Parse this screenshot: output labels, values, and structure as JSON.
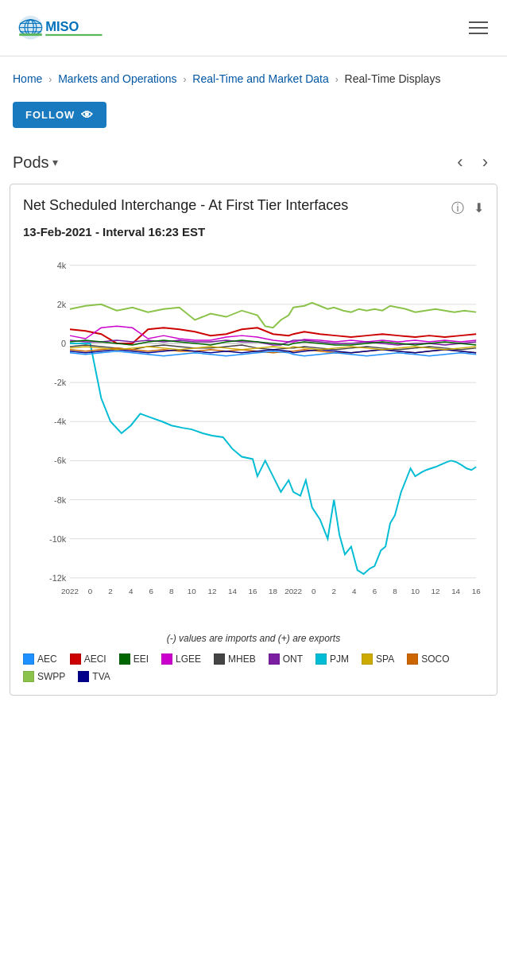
{
  "header": {
    "logo_alt": "MISO",
    "menu_icon": "hamburger-icon"
  },
  "breadcrumb": {
    "home": "Home",
    "markets": "Markets and Operations",
    "realtime": "Real-Time and Market Data",
    "displays": "Real-Time Displays"
  },
  "follow_button": {
    "label": "FOLLOW"
  },
  "pods_nav": {
    "label": "Pods",
    "dropdown_icon": "▾",
    "prev_icon": "‹",
    "next_icon": "›"
  },
  "chart": {
    "title": "Net Scheduled Interchange - At First Tier Interfaces",
    "date_label": "13-Feb-2021 - Interval 16:23 EST",
    "info_icon": "ⓘ",
    "download_icon": "⬇",
    "y_axis_labels": [
      "4k",
      "2k",
      "0",
      "-2k",
      "-4k",
      "-6k",
      "-8k",
      "-10k",
      "-12k"
    ],
    "x_axis_labels": [
      "2022",
      "0",
      "2",
      "4",
      "6",
      "8",
      "10",
      "12",
      "14",
      "16",
      "18",
      "2022",
      "0",
      "2",
      "4",
      "6",
      "8",
      "10",
      "12",
      "14",
      "16"
    ],
    "note": "(-) values are imports and (+) are exports",
    "legend": [
      {
        "key": "AEC",
        "color": "#1e90ff",
        "label": "AEC"
      },
      {
        "key": "AECI",
        "color": "#cc0000",
        "label": "AECI"
      },
      {
        "key": "EEI",
        "color": "#006600",
        "label": "EEI"
      },
      {
        "key": "LGEE",
        "color": "#cc00cc",
        "label": "LGEE"
      },
      {
        "key": "MHEB",
        "color": "#333333",
        "label": "MHEB"
      },
      {
        "key": "ONT",
        "color": "#990099",
        "label": "ONT"
      },
      {
        "key": "PJM",
        "color": "#00cccc",
        "label": "PJM"
      },
      {
        "key": "SPA",
        "color": "#ccaa00",
        "label": "SPA"
      },
      {
        "key": "SOCO",
        "color": "#cc6600",
        "label": "SOCO"
      },
      {
        "key": "SWPP",
        "color": "#88cc00",
        "label": "SWPP"
      },
      {
        "key": "TVA",
        "color": "#00008b",
        "label": "TVA"
      }
    ]
  }
}
